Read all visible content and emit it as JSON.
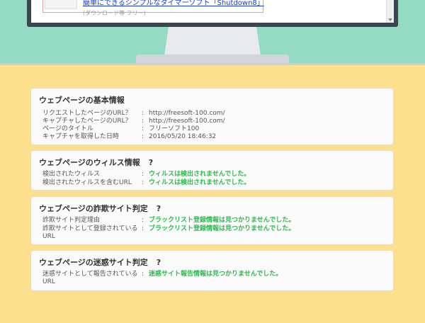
{
  "preview": {
    "link_text": "簡単にできるシンプルなタイマーソフト「Shutdown8」",
    "snippet": "(ダウンロード等 フリー)"
  },
  "sections": {
    "basic": {
      "title": "ウェブページの基本情報",
      "rows": [
        {
          "label": "リクエストしたページのURL？",
          "value": "http://freesoft-100.com/"
        },
        {
          "label": "キャプチャしたページのURL？",
          "value": "http://freesoft-100.com/"
        },
        {
          "label": "ページのタイトル",
          "value": "フリーソフト100"
        },
        {
          "label": "キャプチャを取得した日時",
          "value": "2016/05/20 18:46:32"
        }
      ]
    },
    "virus": {
      "title": "ウェブページのウィルス情報",
      "help": "?",
      "rows": [
        {
          "label": "検出されたウィルス",
          "value": "ウィルスは検出されませんでした。"
        },
        {
          "label": "検出されたウィルスを含むURL",
          "value": "ウィルスは検出されませんでした。"
        }
      ]
    },
    "fraud": {
      "title": "ウェブページの詐欺サイト判定",
      "help": "?",
      "rows": [
        {
          "label": "詐欺サイト判定理由",
          "value": "ブラックリスト登録情報は見つかりませんでした。"
        },
        {
          "label": "詐欺サイトとして登録されている URL",
          "value": "ブラックリスト登録情報は見つかりませんでした。"
        }
      ]
    },
    "spam": {
      "title": "ウェブページの迷惑サイト判定",
      "help": "?",
      "rows": [
        {
          "label": "迷惑サイトとして報告されている URL",
          "value": "迷惑サイト報告情報は見つかりませんでした。"
        }
      ]
    }
  },
  "colon": ":",
  "colors": {
    "ok_text": "#2fb84f",
    "background": "#fde08d",
    "scene": "#95dbc3"
  }
}
